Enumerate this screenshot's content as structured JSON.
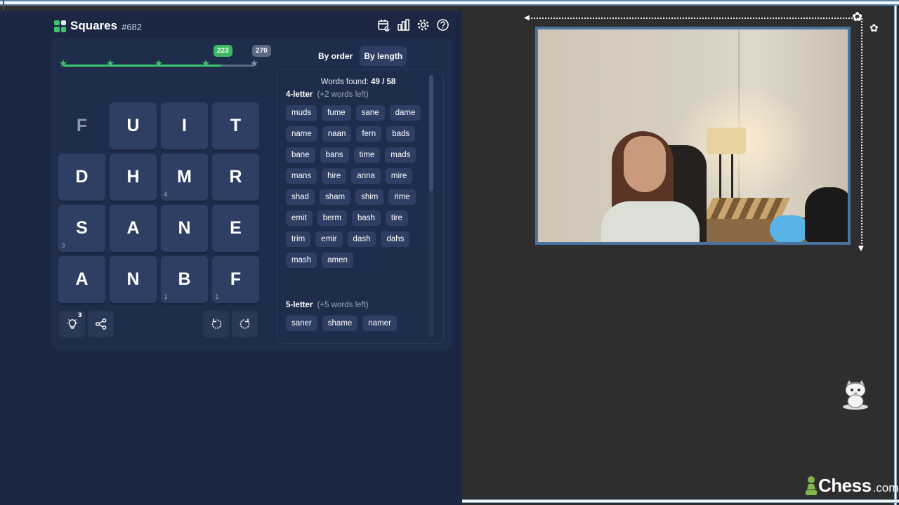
{
  "app": {
    "title": "Squares",
    "number": "#682"
  },
  "header_icons": [
    "calendar-icon",
    "stats-icon",
    "settings-icon",
    "help-icon"
  ],
  "progress": {
    "current_score": "223",
    "max_score": "270",
    "fraction": 0.826,
    "accent": "#3ec46d"
  },
  "grid": [
    {
      "letter": "F",
      "count": "",
      "used": true
    },
    {
      "letter": "U",
      "count": "",
      "used": false
    },
    {
      "letter": "I",
      "count": "",
      "used": false
    },
    {
      "letter": "T",
      "count": "",
      "used": false
    },
    {
      "letter": "D",
      "count": "",
      "used": false
    },
    {
      "letter": "H",
      "count": "",
      "used": false
    },
    {
      "letter": "M",
      "count": "4",
      "used": false
    },
    {
      "letter": "R",
      "count": "",
      "used": false
    },
    {
      "letter": "S",
      "count": "3",
      "used": false
    },
    {
      "letter": "A",
      "count": "",
      "used": false
    },
    {
      "letter": "N",
      "count": "",
      "used": false
    },
    {
      "letter": "E",
      "count": "",
      "used": false
    },
    {
      "letter": "A",
      "count": "",
      "used": false
    },
    {
      "letter": "N",
      "count": "",
      "used": false
    },
    {
      "letter": "B",
      "count": "1",
      "used": false
    },
    {
      "letter": "F",
      "count": "1",
      "used": false
    }
  ],
  "controls": {
    "hint_count": "3"
  },
  "tabs": {
    "by_order": "By order",
    "by_length": "By length",
    "active": "by_length"
  },
  "words_found": {
    "label": "Words found:",
    "value": "49 / 58"
  },
  "sections": [
    {
      "title": "4-letter",
      "remaining": "(+2 words left)",
      "words": [
        "muds",
        "fume",
        "sane",
        "dame",
        "name",
        "naan",
        "fern",
        "bads",
        "bane",
        "bans",
        "time",
        "mads",
        "mans",
        "hire",
        "anna",
        "mire",
        "shad",
        "sham",
        "shim",
        "rime",
        "emit",
        "berm",
        "bash",
        "tire",
        "trim",
        "emir",
        "dash",
        "dahs",
        "mash",
        "amen"
      ]
    },
    {
      "title": "5-letter",
      "remaining": "(+5 words left)",
      "words": [
        "saner",
        "shame",
        "namer"
      ]
    }
  ],
  "branding": {
    "logo_text": "Chess",
    "logo_suffix": ".com"
  }
}
